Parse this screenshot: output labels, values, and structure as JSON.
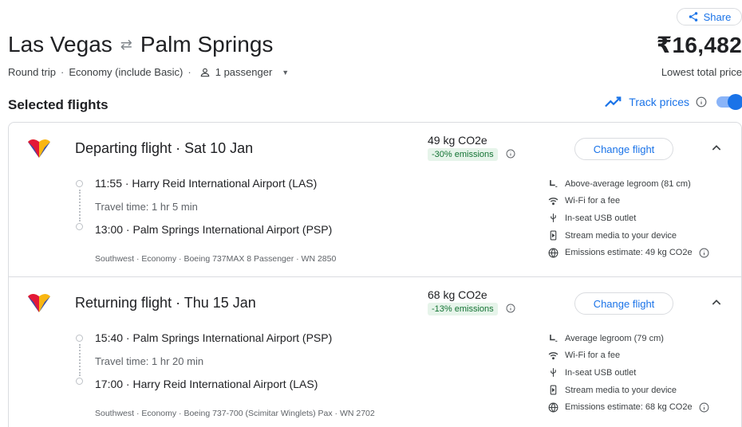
{
  "share_label": "Share",
  "route": {
    "origin": "Las Vegas",
    "destination": "Palm Springs"
  },
  "price": {
    "amount": "₹16,482",
    "label": "Lowest total price"
  },
  "trip_meta": {
    "trip_type": "Round trip",
    "cabin": "Economy (include Basic)",
    "passengers": "1 passenger"
  },
  "section_title": "Selected flights",
  "track_prices": {
    "label": "Track prices",
    "enabled": true
  },
  "colors": {
    "accent": "#1a73e8",
    "emissions_green": "#137333",
    "emissions_bg": "#e6f4ea"
  },
  "flights": [
    {
      "heading": "Departing flight · Sat 10 Jan",
      "co2": "49 kg CO2e",
      "emissions": "-30% emissions",
      "change_label": "Change flight",
      "depart": "11:55 · Harry Reid International Airport (LAS)",
      "travel_time": "Travel time: 1 hr 5 min",
      "arrive": "13:00 · Palm Springs International Airport (PSP)",
      "details": "Southwest · Economy · Boeing 737MAX 8 Passenger · WN 2850",
      "amenities": [
        {
          "icon": "legroom-icon",
          "text": "Above-average legroom (81 cm)"
        },
        {
          "icon": "wifi-icon",
          "text": "Wi-Fi for a fee"
        },
        {
          "icon": "usb-icon",
          "text": "In-seat USB outlet"
        },
        {
          "icon": "stream-media-icon",
          "text": "Stream media to your device"
        },
        {
          "icon": "globe-icon",
          "text": "Emissions estimate: 49 kg CO2e"
        }
      ]
    },
    {
      "heading": "Returning flight · Thu 15 Jan",
      "co2": "68 kg CO2e",
      "emissions": "-13% emissions",
      "change_label": "Change flight",
      "depart": "15:40 · Palm Springs International Airport (PSP)",
      "travel_time": "Travel time: 1 hr 20 min",
      "arrive": "17:00 · Harry Reid International Airport (LAS)",
      "details": "Southwest · Economy · Boeing 737-700 (Scimitar Winglets) Pax · WN 2702",
      "amenities": [
        {
          "icon": "legroom-icon",
          "text": "Average legroom (79 cm)"
        },
        {
          "icon": "wifi-icon",
          "text": "Wi-Fi for a fee"
        },
        {
          "icon": "usb-icon",
          "text": "In-seat USB outlet"
        },
        {
          "icon": "stream-media-icon",
          "text": "Stream media to your device"
        },
        {
          "icon": "globe-icon",
          "text": "Emissions estimate: 68 kg CO2e"
        }
      ]
    }
  ]
}
